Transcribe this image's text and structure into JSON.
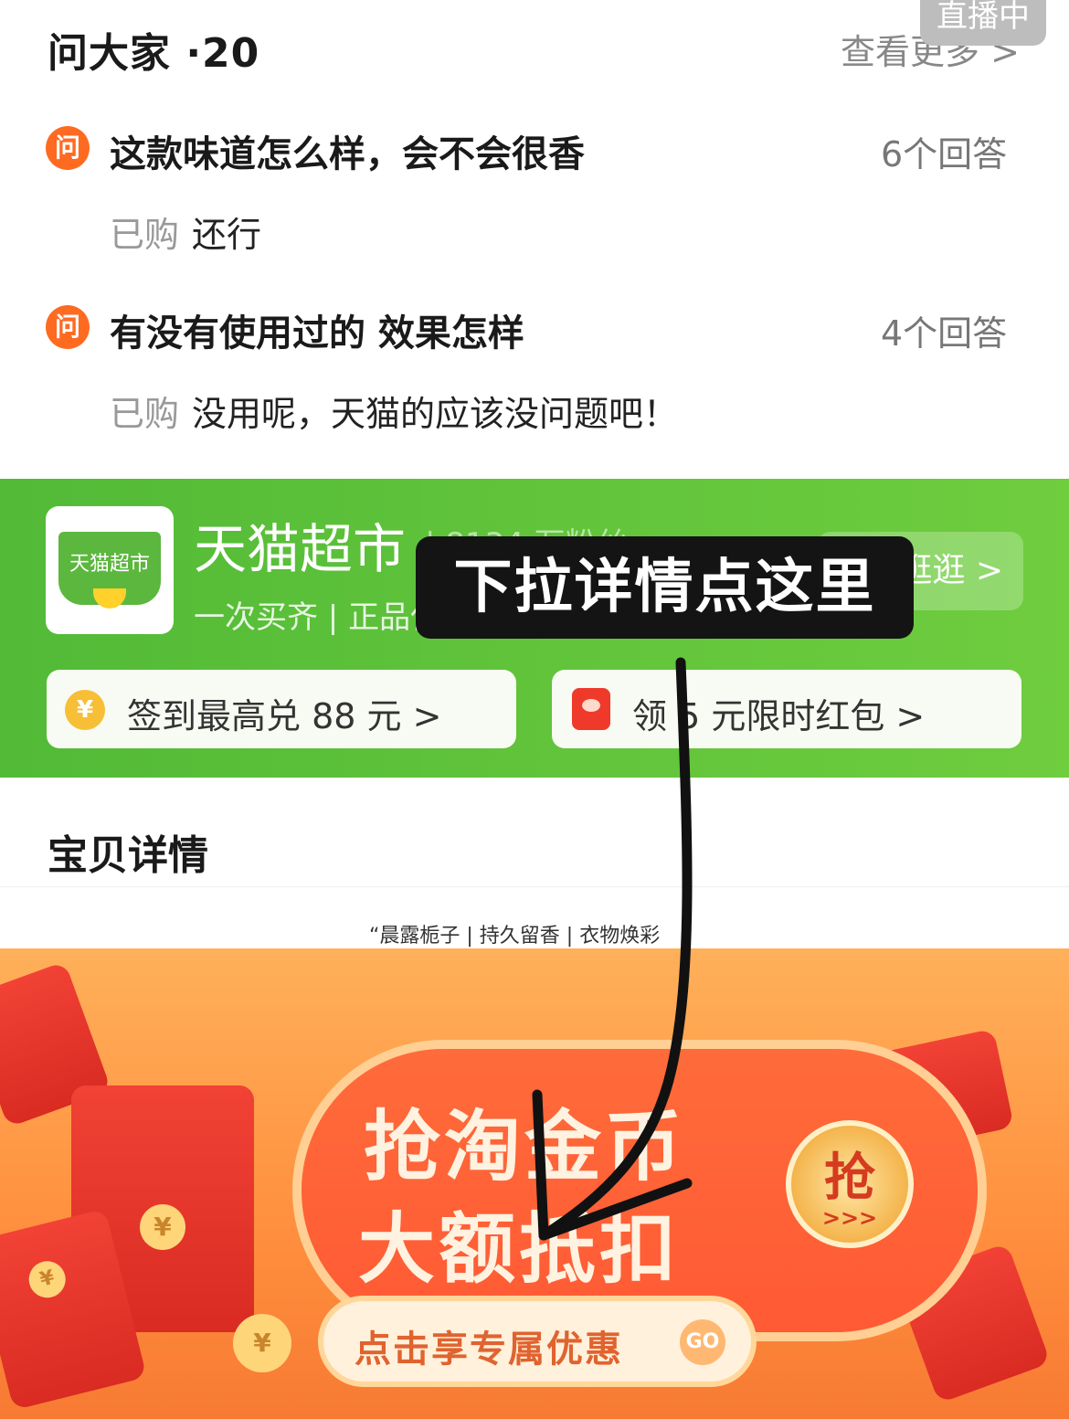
{
  "live_badge": "直播中",
  "qa": {
    "title": "问大家 ·20",
    "more": "查看更多 >",
    "icon_text": "问",
    "items": [
      {
        "question": "这款味道怎么样，会不会很香",
        "answers": "6个回答",
        "tag": "已购",
        "reply": "还行"
      },
      {
        "question": "有没有使用过的  效果怎样",
        "answers": "4个回答",
        "tag": "已购",
        "reply": "没用呢，天猫的应该没问题吧！"
      }
    ]
  },
  "store": {
    "logo_text": "天猫超市",
    "name": "天猫超市",
    "fans": "| 8134 万粉丝",
    "tags": "一次买齐  |  正品保证  |  退换正向",
    "visit_label": "进店逛逛 >",
    "pill_left": "签到最高兑 88 元 >",
    "pill_left_icon": "¥",
    "pill_right": "领 5 元限时红包 >",
    "colors": {
      "band": "#5bbf3a",
      "accent": "#ff6a21"
    }
  },
  "detail": {
    "title": "宝贝详情",
    "slogan": "“晨露栀子 | 持久留香 | 衣物焕彩"
  },
  "banner": {
    "line1": "抢淘金币",
    "line2": "大额抵扣",
    "grab": "抢",
    "grab_arrows": ">>>",
    "cta": "点击享专属优惠",
    "go": "GO",
    "coin_symbol": "¥"
  },
  "overlay": {
    "tip": "下拉详情点这里"
  }
}
